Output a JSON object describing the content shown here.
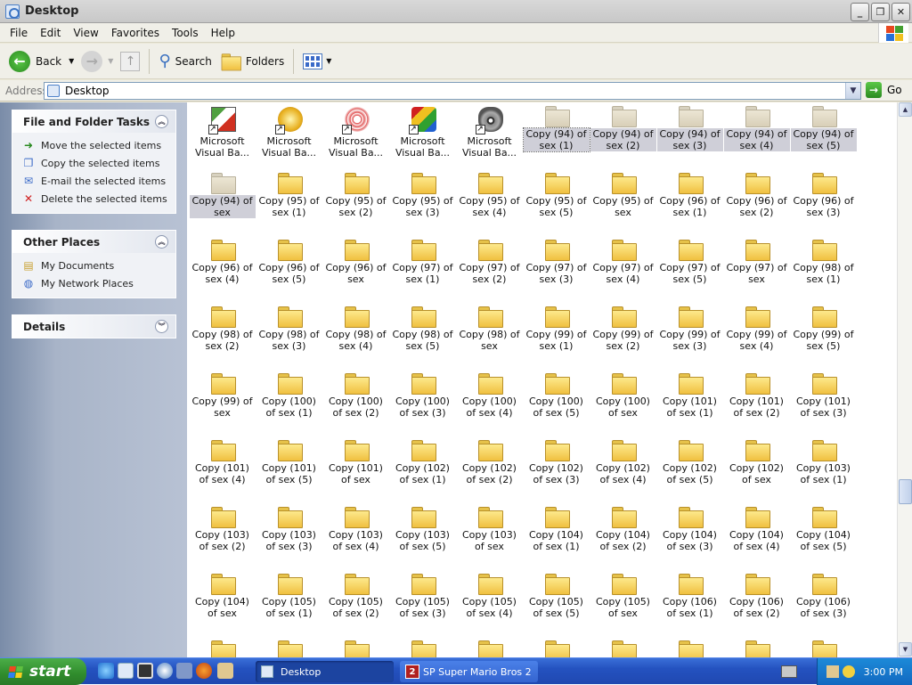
{
  "window": {
    "title": "Desktop"
  },
  "menu": [
    "File",
    "Edit",
    "View",
    "Favorites",
    "Tools",
    "Help"
  ],
  "toolbar": {
    "back": "Back",
    "search": "Search",
    "folders": "Folders"
  },
  "address": {
    "label": "Address",
    "value": "Desktop",
    "go": "Go"
  },
  "panels": {
    "tasks": {
      "title": "File and Folder Tasks",
      "items": [
        "Move the selected items",
        "Copy the selected items",
        "E-mail the selected items",
        "Delete the selected items"
      ]
    },
    "places": {
      "title": "Other Places",
      "items": [
        "My Documents",
        "My Network Places"
      ]
    },
    "details": {
      "title": "Details"
    }
  },
  "icons": [
    {
      "label": "Microsoft Visual Ba...",
      "kind": "app1"
    },
    {
      "label": "Microsoft Visual Ba...",
      "kind": "app2"
    },
    {
      "label": "Microsoft Visual Ba...",
      "kind": "app3"
    },
    {
      "label": "Microsoft Visual Ba...",
      "kind": "app4"
    },
    {
      "label": "Microsoft Visual Ba...",
      "kind": "app5"
    },
    {
      "label": "Copy (94) of sex (1)",
      "kind": "pale",
      "sel": "focus"
    },
    {
      "label": "Copy (94) of sex (2)",
      "kind": "pale",
      "sel": "yes"
    },
    {
      "label": "Copy (94) of sex (3)",
      "kind": "pale",
      "sel": "yes"
    },
    {
      "label": "Copy (94) of sex (4)",
      "kind": "pale",
      "sel": "yes"
    },
    {
      "label": "Copy (94) of sex (5)",
      "kind": "pale",
      "sel": "yes"
    },
    {
      "label": "Copy (94) of sex",
      "kind": "pale",
      "sel": "yes"
    },
    {
      "label": "Copy (95) of sex (1)"
    },
    {
      "label": "Copy (95) of sex (2)"
    },
    {
      "label": "Copy (95) of sex (3)"
    },
    {
      "label": "Copy (95) of sex (4)"
    },
    {
      "label": "Copy (95) of sex (5)"
    },
    {
      "label": "Copy (95) of sex"
    },
    {
      "label": "Copy (96) of sex (1)"
    },
    {
      "label": "Copy (96) of sex (2)"
    },
    {
      "label": "Copy (96) of sex (3)"
    },
    {
      "label": "Copy (96) of sex (4)"
    },
    {
      "label": "Copy (96) of sex (5)"
    },
    {
      "label": "Copy (96) of sex"
    },
    {
      "label": "Copy (97) of sex (1)"
    },
    {
      "label": "Copy (97) of sex (2)"
    },
    {
      "label": "Copy (97) of sex (3)"
    },
    {
      "label": "Copy (97) of sex (4)"
    },
    {
      "label": "Copy (97) of sex (5)"
    },
    {
      "label": "Copy (97) of sex"
    },
    {
      "label": "Copy (98) of sex (1)"
    },
    {
      "label": "Copy (98) of sex (2)"
    },
    {
      "label": "Copy (98) of sex (3)"
    },
    {
      "label": "Copy (98) of sex (4)"
    },
    {
      "label": "Copy (98) of sex (5)"
    },
    {
      "label": "Copy (98) of sex"
    },
    {
      "label": "Copy (99) of sex (1)"
    },
    {
      "label": "Copy (99) of sex (2)"
    },
    {
      "label": "Copy (99) of sex (3)"
    },
    {
      "label": "Copy (99) of sex (4)"
    },
    {
      "label": "Copy (99) of sex (5)"
    },
    {
      "label": "Copy (99) of sex"
    },
    {
      "label": "Copy (100) of sex (1)"
    },
    {
      "label": "Copy (100) of sex (2)"
    },
    {
      "label": "Copy (100) of sex (3)"
    },
    {
      "label": "Copy (100) of sex (4)"
    },
    {
      "label": "Copy (100) of sex (5)"
    },
    {
      "label": "Copy (100) of sex"
    },
    {
      "label": "Copy (101) of sex (1)"
    },
    {
      "label": "Copy (101) of sex (2)"
    },
    {
      "label": "Copy (101) of sex (3)"
    },
    {
      "label": "Copy (101) of sex (4)"
    },
    {
      "label": "Copy (101) of sex (5)"
    },
    {
      "label": "Copy (101) of sex"
    },
    {
      "label": "Copy (102) of sex (1)"
    },
    {
      "label": "Copy (102) of sex (2)"
    },
    {
      "label": "Copy (102) of sex (3)"
    },
    {
      "label": "Copy (102) of sex (4)"
    },
    {
      "label": "Copy (102) of sex (5)"
    },
    {
      "label": "Copy (102) of sex"
    },
    {
      "label": "Copy (103) of sex (1)"
    },
    {
      "label": "Copy (103) of sex (2)"
    },
    {
      "label": "Copy (103) of sex (3)"
    },
    {
      "label": "Copy (103) of sex (4)"
    },
    {
      "label": "Copy (103) of sex (5)"
    },
    {
      "label": "Copy (103) of sex"
    },
    {
      "label": "Copy (104) of sex (1)"
    },
    {
      "label": "Copy (104) of sex (2)"
    },
    {
      "label": "Copy (104) of sex (3)"
    },
    {
      "label": "Copy (104) of sex (4)"
    },
    {
      "label": "Copy (104) of sex (5)"
    },
    {
      "label": "Copy (104) of sex"
    },
    {
      "label": "Copy (105) of sex (1)"
    },
    {
      "label": "Copy (105) of sex (2)"
    },
    {
      "label": "Copy (105) of sex (3)"
    },
    {
      "label": "Copy (105) of sex (4)"
    },
    {
      "label": "Copy (105) of sex (5)"
    },
    {
      "label": "Copy (105) of sex"
    },
    {
      "label": "Copy (106) of sex (1)"
    },
    {
      "label": "Copy (106) of sex (2)"
    },
    {
      "label": "Copy (106) of sex (3)"
    },
    {
      "label": ""
    },
    {
      "label": ""
    },
    {
      "label": ""
    },
    {
      "label": ""
    },
    {
      "label": ""
    },
    {
      "label": ""
    },
    {
      "label": ""
    },
    {
      "label": ""
    },
    {
      "label": ""
    },
    {
      "label": ""
    }
  ],
  "taskbar": {
    "start": "start",
    "tasks": [
      "Desktop",
      "SP Super Mario Bros 2"
    ],
    "clock": "3:00 PM"
  },
  "colors": {
    "taskbar": "#2452c0",
    "start": "#2f8b2c",
    "folder": "#f0c040",
    "selection": "#cfcfd8"
  }
}
